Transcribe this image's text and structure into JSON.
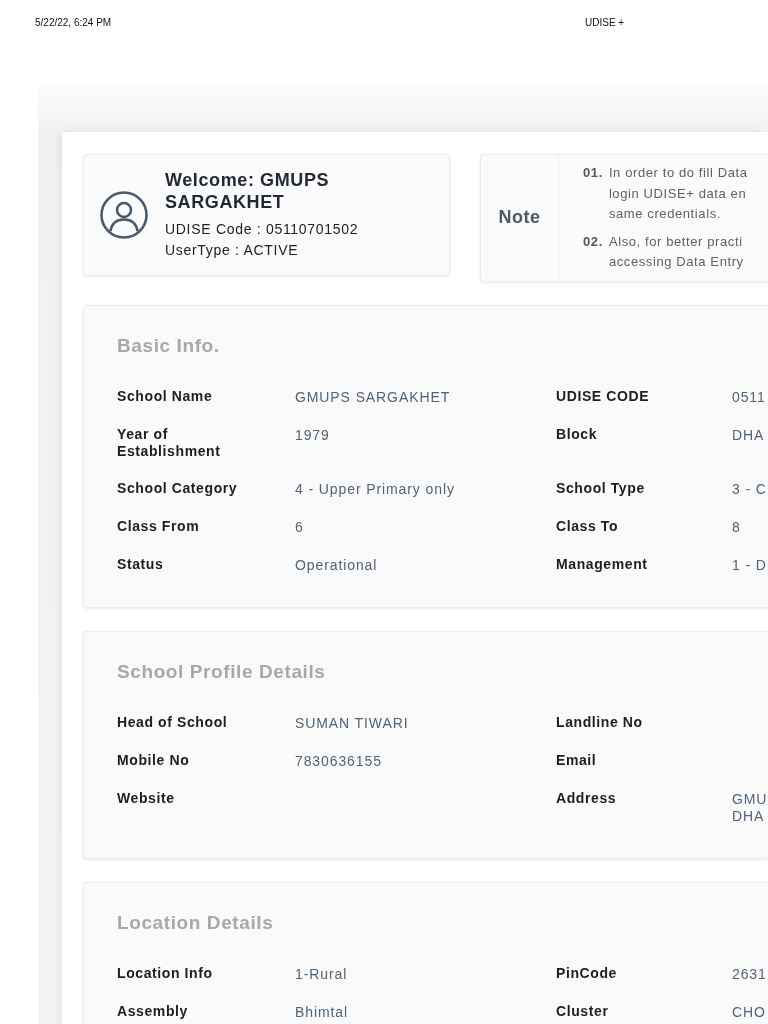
{
  "print_header": {
    "date": "5/22/22, 6:24 PM",
    "title": "UDISE +"
  },
  "welcome": {
    "title": "Welcome: GMUPS SARGAKHET",
    "udise_code": "UDISE Code : 05110701502",
    "user_type": "UserType : ACTIVE"
  },
  "note": {
    "label": "Note",
    "items": [
      {
        "number": "01.",
        "text": "In order to do fill Data\nlogin UDISE+ data en\nsame credentials."
      },
      {
        "number": "02.",
        "text": "Also, for better practi\naccessing Data Entry"
      }
    ]
  },
  "sections": [
    {
      "title": "Basic Info.",
      "fields": [
        {
          "label": "School Name",
          "value": "GMUPS SARGAKHET"
        },
        {
          "label": "UDISE CODE",
          "value": "0511"
        },
        {
          "label": "Year of Establishment",
          "value": "1979"
        },
        {
          "label": "Block",
          "value": "DHA"
        },
        {
          "label": "School Category",
          "value": "4 - Upper Primary only"
        },
        {
          "label": "School Type",
          "value": "3 - C"
        },
        {
          "label": "Class From",
          "value": "6"
        },
        {
          "label": "Class To",
          "value": "8"
        },
        {
          "label": "Status",
          "value": "Operational"
        },
        {
          "label": "Management",
          "value": "1 - D"
        }
      ]
    },
    {
      "title": "School Profile Details",
      "fields": [
        {
          "label": "Head of School",
          "value": "SUMAN TIWARI"
        },
        {
          "label": "Landline No"
        },
        {
          "label": "Mobile No",
          "value": "7830636155"
        },
        {
          "label": "Email"
        },
        {
          "label": "Website"
        },
        {
          "label": "Address",
          "value": "GMU\nDHA"
        }
      ]
    },
    {
      "title": "Location Details",
      "fields": [
        {
          "label": "Location Info",
          "value": "1-Rural"
        },
        {
          "label": "PinCode",
          "value": "2631"
        },
        {
          "label": "Assembly",
          "value": "Bhimtal"
        },
        {
          "label": "Cluster",
          "value": "CHO"
        }
      ]
    }
  ]
}
